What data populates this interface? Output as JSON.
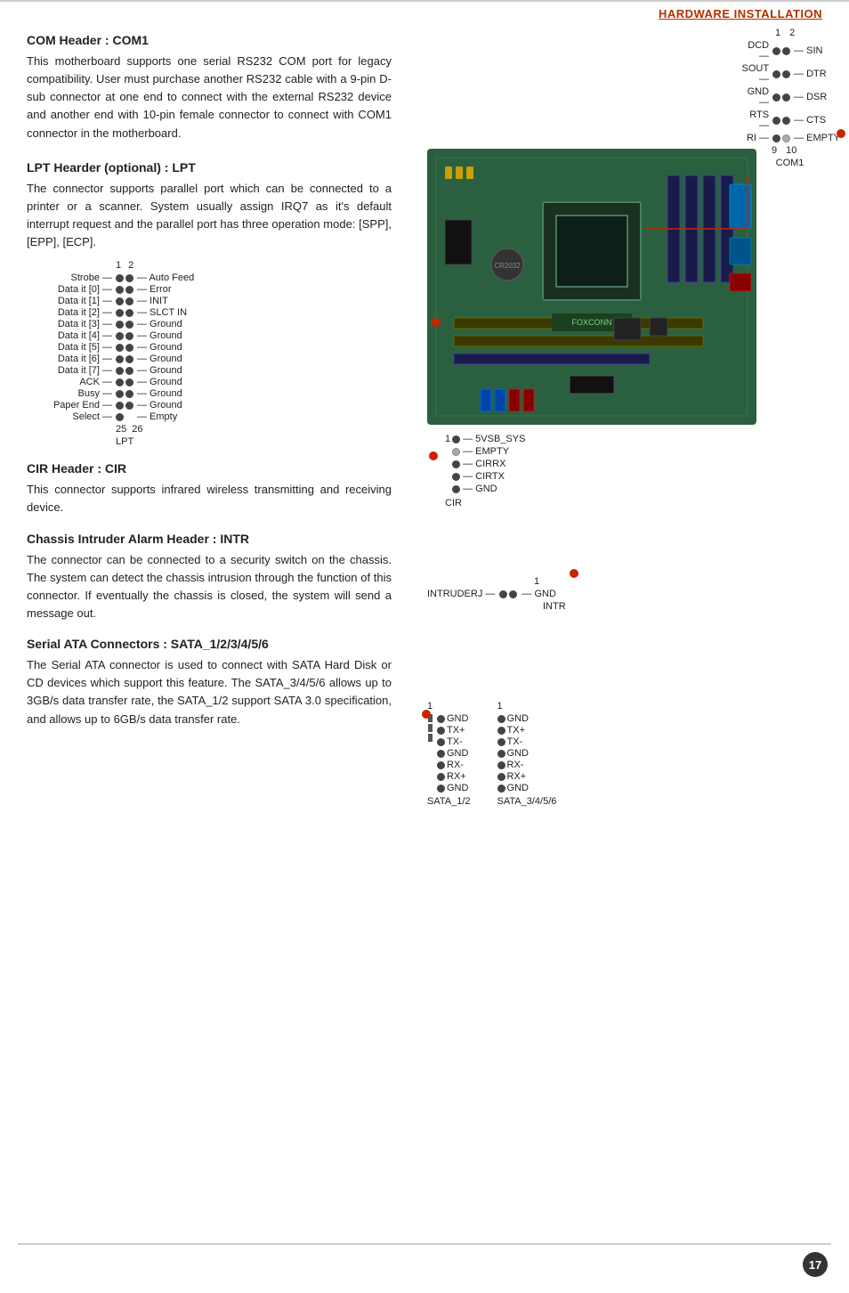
{
  "header": {
    "title": "HARDWARE INSTALLATION",
    "link_color": "#b03000"
  },
  "page_number": "17",
  "sections": [
    {
      "id": "com1",
      "title": "COM Header : COM1",
      "body": "This motherboard supports one serial RS232 COM port for legacy compatibility. User must purchase another RS232 cable with a 9-pin D-sub connector at one end to connect with the external RS232 device and another end with 10-pin female connector to connect with COM1 connector in the motherboard."
    },
    {
      "id": "lpt",
      "title": "LPT Hearder (optional) : LPT",
      "body": "The connector supports parallel port which can be connected to a printer or a scanner. System usually assign IRQ7 as it's default interrupt request and the parallel port has three operation mode: [SPP], [EPP], [ECP]."
    },
    {
      "id": "cir",
      "title": "CIR Header : CIR",
      "body": "This connector supports infrared wireless transmitting and receiving device."
    },
    {
      "id": "chassis",
      "title": "Chassis Intruder Alarm Header : INTR",
      "body": "The connector can be connected to a security switch on the chassis. The system can detect the chassis intrusion through the function of this connector. If eventually the chassis is closed, the system will send a message out."
    },
    {
      "id": "sata",
      "title": "Serial ATA Connectors : SATA_1/2/3/4/5/6",
      "body": "The Serial ATA connector is used to connect with SATA Hard Disk or CD devices which support this feature. The SATA_3/4/5/6 allows up to 3GB/s data transfer rate, the SATA_1/2 support SATA 3.0 specification, and allows up to 6GB/s data transfer rate."
    }
  ],
  "com1_diagram": {
    "nums": [
      "1",
      "2"
    ],
    "pins": [
      {
        "left": "DCD",
        "right": "SIN"
      },
      {
        "left": "SOUT",
        "right": "DTR"
      },
      {
        "left": "GND",
        "right": "DSR"
      },
      {
        "left": "RTS",
        "right": "CTS"
      },
      {
        "left": "RI",
        "right": "EMPTY"
      }
    ],
    "bottom_nums": [
      "9",
      "10"
    ],
    "label": "COM1"
  },
  "lpt_diagram": {
    "nums": [
      "1",
      "2"
    ],
    "pins": [
      {
        "left": "Strobe",
        "right": "Auto Feed"
      },
      {
        "left": "Data it [0]",
        "right": "Error"
      },
      {
        "left": "Data it [1]",
        "right": "INIT"
      },
      {
        "left": "Data it [2]",
        "right": "SLCT IN"
      },
      {
        "left": "Data it [3]",
        "right": "Ground"
      },
      {
        "left": "Data it [4]",
        "right": "Ground"
      },
      {
        "left": "Data it [5]",
        "right": "Ground"
      },
      {
        "left": "Data it [6]",
        "right": "Ground"
      },
      {
        "left": "Data it [7]",
        "right": "Ground"
      },
      {
        "left": "ACK",
        "right": "Ground"
      },
      {
        "left": "Busy",
        "right": "Ground"
      },
      {
        "left": "Paper End",
        "right": "Ground"
      },
      {
        "left": "Select",
        "right": "Empty"
      }
    ],
    "bottom_nums": [
      "25",
      "26"
    ],
    "label": "LPT"
  },
  "cir_diagram": {
    "label": "CIR",
    "start_num": "1",
    "pins": [
      "5VSB_SYS",
      "EMPTY",
      "CIRRX",
      "CIRTX",
      "GND"
    ]
  },
  "intr_diagram": {
    "label": "INTR",
    "start_num": "1",
    "left_label": "INTRUDERJ",
    "right_label": "GND"
  },
  "sata_diagrams": [
    {
      "label": "SATA_1/2",
      "start_num": "1",
      "pins": [
        "GND",
        "TX+",
        "TX-",
        "GND",
        "RX-",
        "RX+",
        "GND"
      ]
    },
    {
      "label": "SATA_3/4/5/6",
      "start_num": "1",
      "pins": [
        "GND",
        "TX+",
        "TX-",
        "GND",
        "RX-",
        "RX+",
        "GND"
      ]
    }
  ]
}
